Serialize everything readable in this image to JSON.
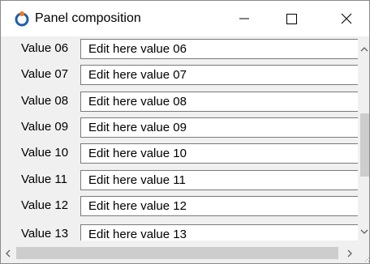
{
  "window": {
    "title": "Panel composition",
    "icon": "app-logo-icon",
    "controls": [
      "minimize-icon",
      "maximize-icon",
      "close-icon"
    ]
  },
  "rows": [
    {
      "label": "Value 06",
      "value": "Edit here value 06"
    },
    {
      "label": "Value 07",
      "value": "Edit here value 07"
    },
    {
      "label": "Value 08",
      "value": "Edit here value 08"
    },
    {
      "label": "Value 09",
      "value": "Edit here value 09"
    },
    {
      "label": "Value 10",
      "value": "Edit here value 10"
    },
    {
      "label": "Value 11",
      "value": "Edit here value 11"
    },
    {
      "label": "Value 12",
      "value": "Edit here value 12"
    },
    {
      "label": "Value 13",
      "value": "Edit here value 13"
    }
  ],
  "scrollbars": {
    "vertical": {
      "up": "chevron-up-icon",
      "down": "chevron-down-icon"
    },
    "horizontal": {
      "left": "chevron-left-icon",
      "right": "chevron-right-icon"
    }
  }
}
